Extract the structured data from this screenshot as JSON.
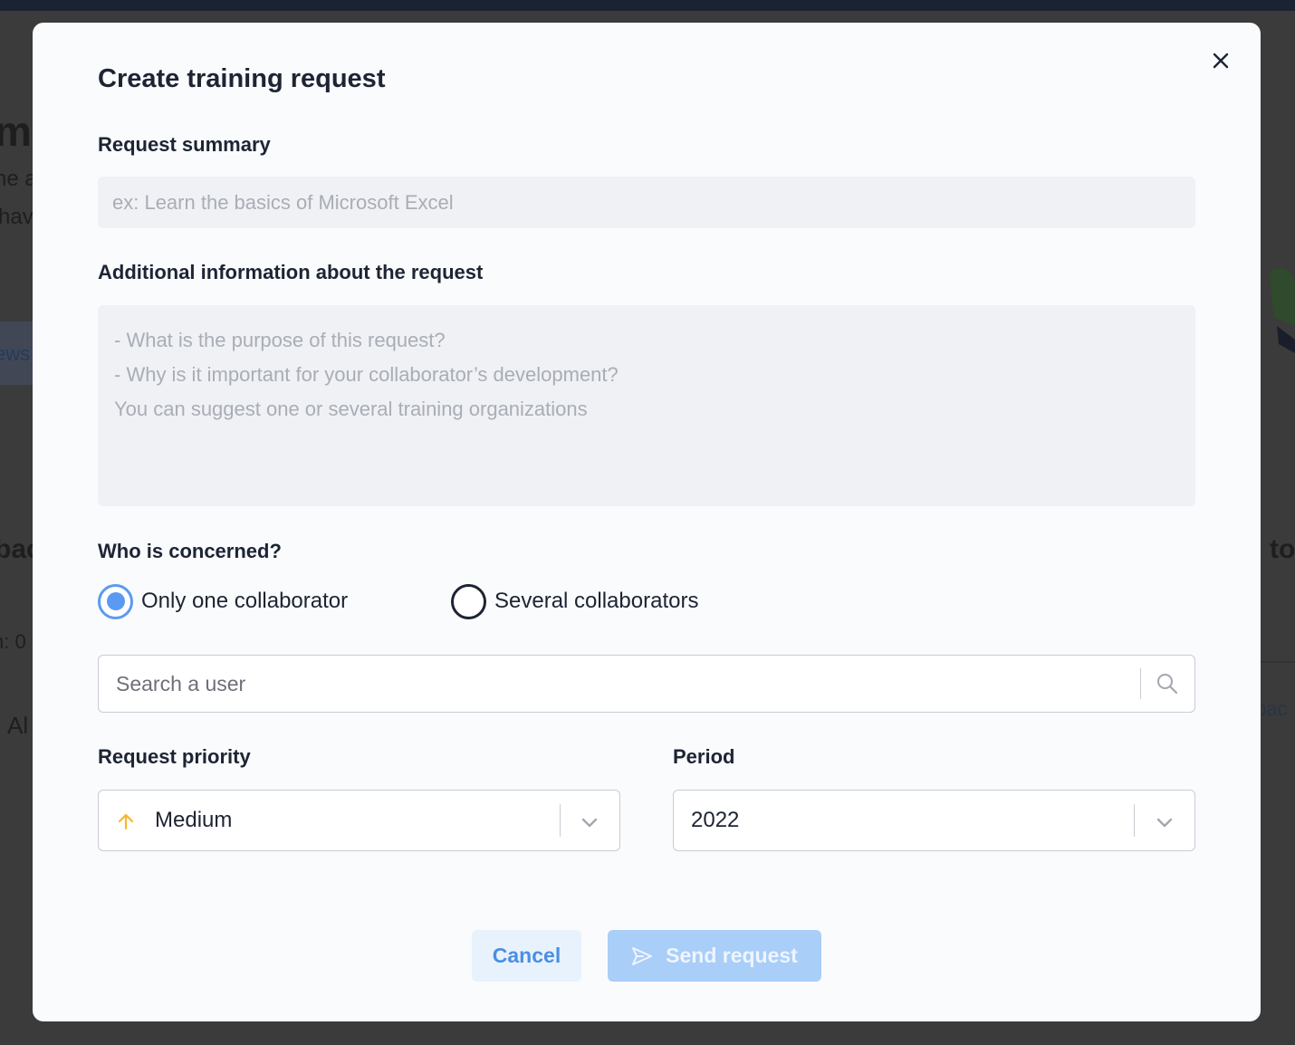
{
  "background": {
    "left_fragments": [
      "me",
      "ne a",
      "hav",
      "ews",
      "bac",
      "n: 0",
      "Al"
    ],
    "right_fragments": [
      "to",
      "bac"
    ]
  },
  "modal": {
    "title": "Create training request",
    "summary": {
      "label": "Request summary",
      "placeholder": "ex: Learn the basics of Microsoft Excel",
      "value": ""
    },
    "details": {
      "label": "Additional information about the request",
      "placeholder": "- What is the purpose of this request?\n- Why is it important for your collaborator’s development?\nYou can suggest one or several training organizations",
      "value": ""
    },
    "concerned": {
      "label": "Who is concerned?",
      "options": [
        {
          "label": "Only one collaborator",
          "selected": true
        },
        {
          "label": "Several collaborators",
          "selected": false
        }
      ]
    },
    "user_search": {
      "placeholder": "Search a user",
      "value": "",
      "icon": "search-icon"
    },
    "priority": {
      "label": "Request priority",
      "value": "Medium",
      "icon": "arrow-up-icon",
      "icon_color": "#f5b82e"
    },
    "period": {
      "label": "Period",
      "value": "2022"
    },
    "actions": {
      "cancel_label": "Cancel",
      "send_label": "Send request",
      "send_icon": "send-icon"
    },
    "colors": {
      "accent": "#5b9af2",
      "send_disabled": "#a9cef8",
      "cancel_bg": "#e8f2fd"
    }
  }
}
